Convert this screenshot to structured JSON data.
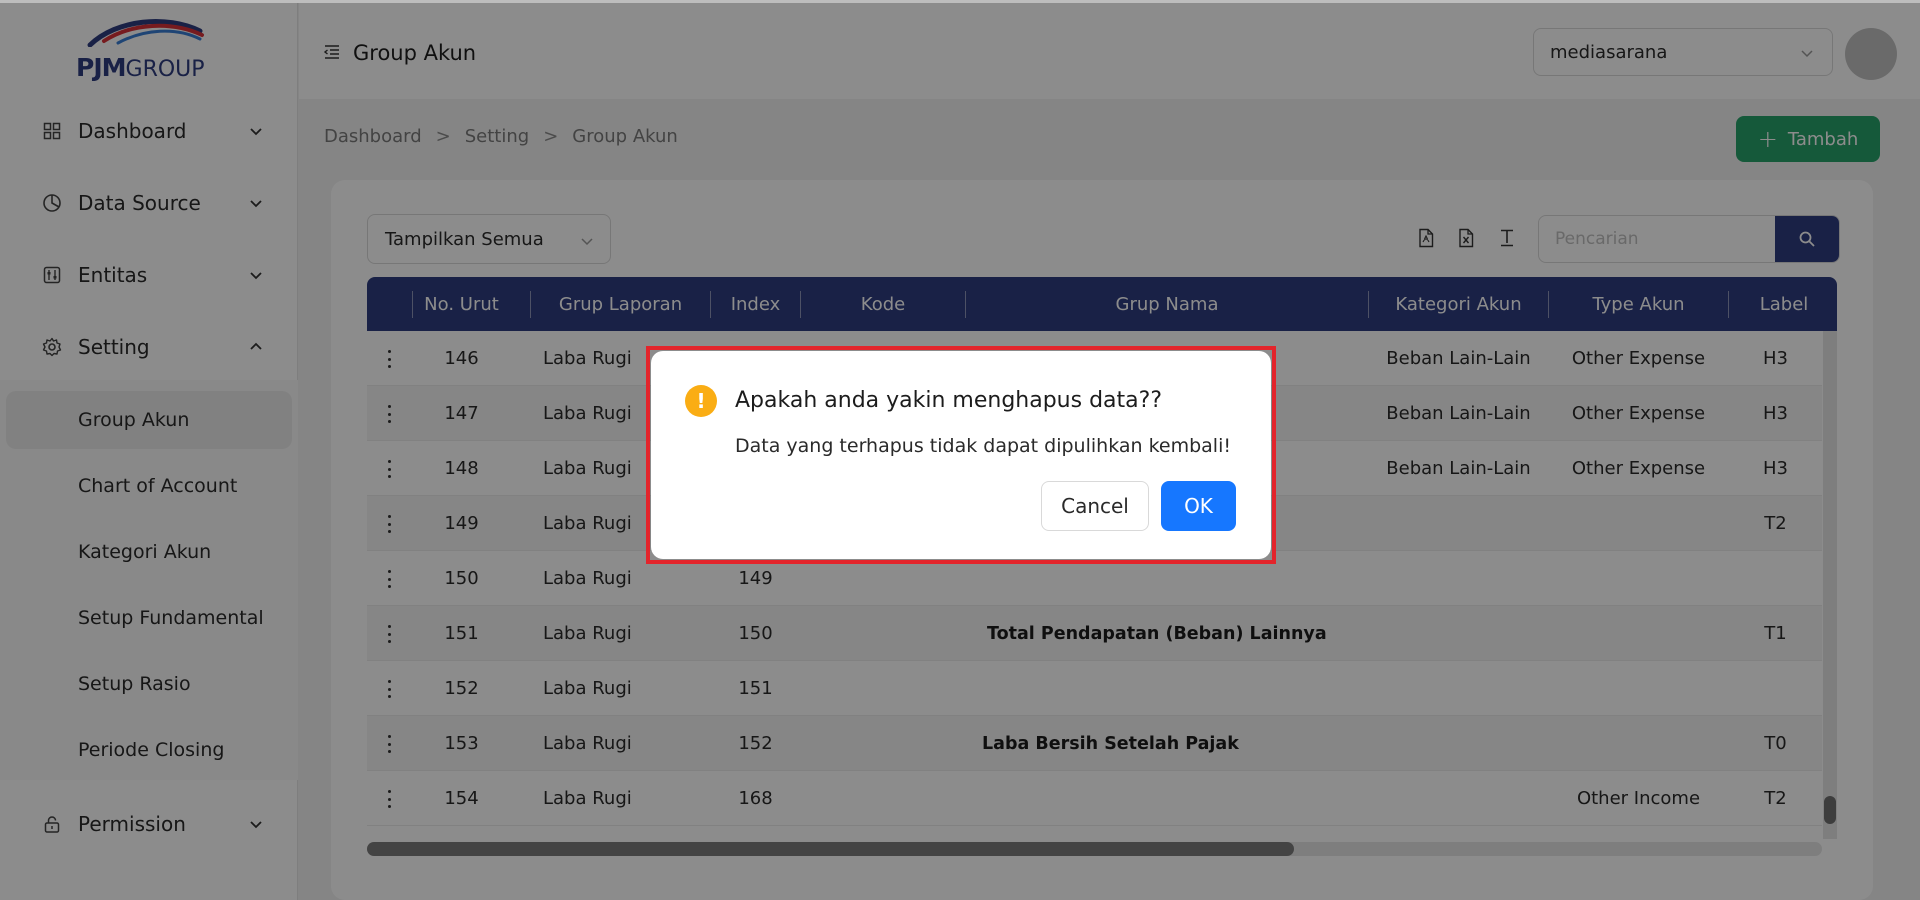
{
  "brand": {
    "logo_main": "PJM",
    "logo_sub": "GROUP",
    "colors": {
      "primary": "#2f3c80",
      "swoosh_red": "#d8323a",
      "swoosh_blue": "#3a7fd5"
    }
  },
  "sidebar": {
    "items": [
      {
        "label": "Dashboard",
        "icon": "grid-icon"
      },
      {
        "label": "Data Source",
        "icon": "pie-chart-icon"
      },
      {
        "label": "Entitas",
        "icon": "sliders-icon"
      },
      {
        "label": "Setting",
        "icon": "gear-icon"
      },
      {
        "label": "Permission",
        "icon": "lock-icon"
      }
    ],
    "setting_children": [
      {
        "label": "Group Akun",
        "active": true
      },
      {
        "label": "Chart of Account"
      },
      {
        "label": "Kategori Akun"
      },
      {
        "label": "Setup Fundamental"
      },
      {
        "label": "Setup Rasio"
      },
      {
        "label": "Periode Closing"
      }
    ]
  },
  "header": {
    "title": "Group Akun",
    "company": "mediasarana"
  },
  "breadcrumb": [
    "Dashboard",
    "Setting",
    "Group Akun"
  ],
  "breadcrumb_sep": ">",
  "toolbar": {
    "add_label": "Tambah",
    "filter_value": "Tampilkan Semua",
    "search_placeholder": "Pencarian",
    "tools": [
      "pdf-export-icon",
      "excel-export-icon",
      "text-format-icon"
    ]
  },
  "table": {
    "columns": [
      "No. Urut",
      "Grup Laporan",
      "Index",
      "Kode",
      "Grup Nama",
      "Kategori Akun",
      "Type Akun",
      "Label"
    ],
    "rows": [
      {
        "no": "146",
        "grup": "Laba Rugi",
        "index": "",
        "kode": "",
        "nama": "",
        "kategori": "Beban Lain-Lain",
        "type": "Other Expense",
        "label": "H3"
      },
      {
        "no": "147",
        "grup": "Laba Rugi",
        "index": "",
        "kode": "",
        "nama": "",
        "kategori": "Beban Lain-Lain",
        "type": "Other Expense",
        "label": "H3"
      },
      {
        "no": "148",
        "grup": "Laba Rugi",
        "index": "",
        "kode": "",
        "nama": "",
        "kategori": "Beban Lain-Lain",
        "type": "Other Expense",
        "label": "H3"
      },
      {
        "no": "149",
        "grup": "Laba Rugi",
        "index": "",
        "kode": "",
        "nama": "",
        "kategori": "",
        "type": "",
        "label": "T2"
      },
      {
        "no": "150",
        "grup": "Laba Rugi",
        "index": "149",
        "kode": "",
        "nama": "",
        "kategori": "",
        "type": "",
        "label": ""
      },
      {
        "no": "151",
        "grup": "Laba Rugi",
        "index": "150",
        "kode": "",
        "nama": "Total Pendapatan (Beban) Lainnya",
        "kategori": "",
        "type": "",
        "label": "T1"
      },
      {
        "no": "152",
        "grup": "Laba Rugi",
        "index": "151",
        "kode": "",
        "nama": "",
        "kategori": "",
        "type": "",
        "label": ""
      },
      {
        "no": "153",
        "grup": "Laba Rugi",
        "index": "152",
        "kode": "",
        "nama": "Laba Bersih Setelah Pajak",
        "kategori": "",
        "type": "",
        "label": "T0"
      },
      {
        "no": "154",
        "grup": "Laba Rugi",
        "index": "168",
        "kode": "",
        "nama": "",
        "kategori": "",
        "type": "Other Income",
        "label": "T2"
      }
    ]
  },
  "modal": {
    "title": "Apakah anda yakin menghapus data??",
    "message": "Data yang terhapus tidak dapat dipulihkan kembali!",
    "icon": "!",
    "cancel_label": "Cancel",
    "ok_label": "OK",
    "colors": {
      "warning": "#faad14",
      "ok": "#1677ff",
      "outline": "#e3242b"
    }
  }
}
